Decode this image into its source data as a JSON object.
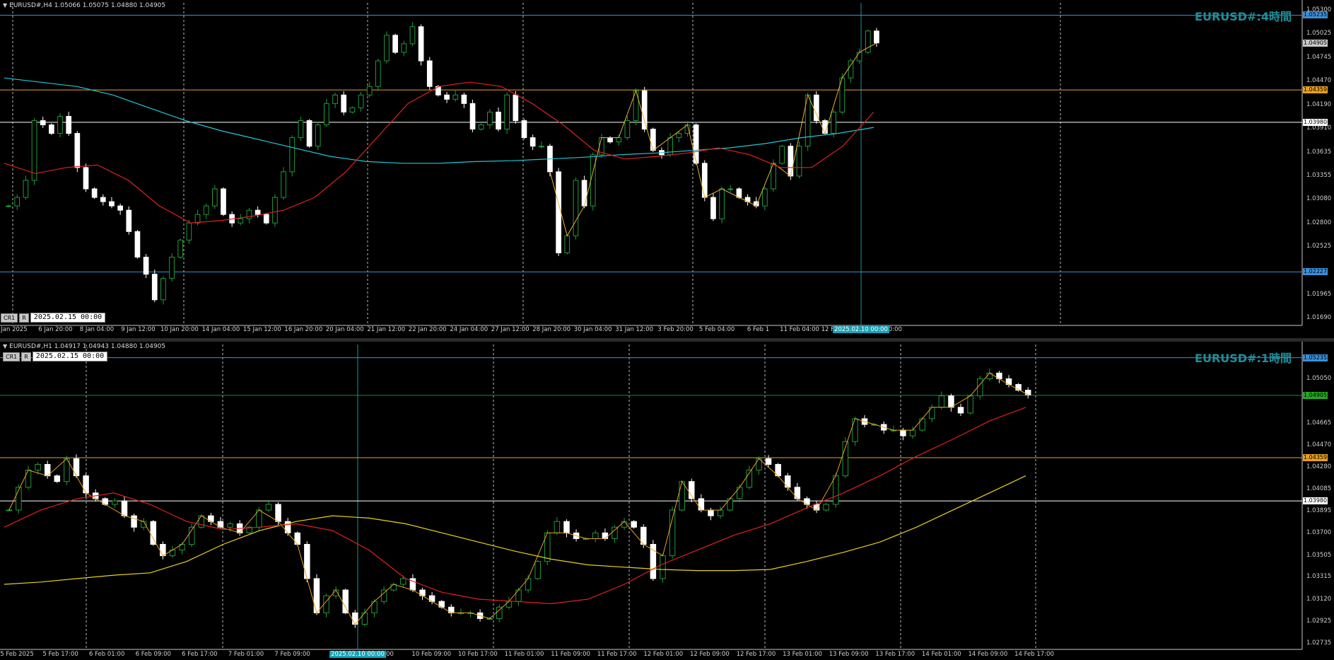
{
  "window": {
    "top_border_color": "#00c000"
  },
  "chart_data": [
    {
      "type": "candlestick",
      "symbol_label": "EURUSD#:4時間",
      "header": "EURUSD#,H4  1.05066 1.05075 1.04880 1.04905",
      "controls": {
        "btn1": "CR1",
        "btn2": "R",
        "date": "2025.02.15 00:00"
      },
      "y_ticks": [
        "1.05300",
        "1.05025",
        "1.04745",
        "1.04470",
        "1.04190",
        "1.03910",
        "1.03635",
        "1.03355",
        "1.03080",
        "1.02800",
        "1.02525",
        "1.01965",
        "1.01690"
      ],
      "price_tags": [
        {
          "value": "1.05235",
          "color": "#3a8fd9"
        },
        {
          "value": "1.04905",
          "color": "#c8c8c8"
        },
        {
          "value": "1.04359",
          "color": "#e8a020"
        },
        {
          "value": "1.03980",
          "color": "#ffffff"
        },
        {
          "value": "1.02227",
          "color": "#3a8fd9"
        }
      ],
      "x_ticks": [
        "Jan 2025",
        "6 Jan 20:00",
        "8 Jan 04:00",
        "9 Jan 12:00",
        "10 Jan 20:00",
        "14 Jan 04:00",
        "15 Jan 12:00",
        "16 Jan 20:00",
        "20 Jan 04:00",
        "21 Jan 12:00",
        "22 Jan 20:00",
        "24 Jan 04:00",
        "27 Jan 12:00",
        "28 Jan 20:00",
        "30 Jan 04:00",
        "31 Jan 12:00",
        "3 Feb 20:00",
        "5 Feb 04:00",
        "6 Feb 1",
        "11 Feb 04:00",
        "12 Feb 12:00",
        "13 Feb 20:00"
      ],
      "x_cursor": "2025.02.10 00:00",
      "ylim": [
        1.016,
        1.0538
      ],
      "hlines": [
        {
          "y": 1.05235,
          "color": "#3a8fd9"
        },
        {
          "y": 1.04359,
          "color": "#e8a020"
        },
        {
          "y": 1.0398,
          "color": "#ffffff"
        },
        {
          "y": 1.02227,
          "color": "#3a8fd9"
        }
      ],
      "close": [
        1.03,
        1.031,
        1.033,
        1.04,
        1.0395,
        1.0385,
        1.0405,
        1.0385,
        1.0345,
        1.032,
        1.031,
        1.0305,
        1.03,
        1.0295,
        1.027,
        1.024,
        1.022,
        1.019,
        1.0215,
        1.024,
        1.026,
        1.028,
        1.029,
        1.03,
        1.032,
        1.029,
        1.028,
        1.0285,
        1.0295,
        1.029,
        1.028,
        1.031,
        1.034,
        1.038,
        1.04,
        1.037,
        1.0395,
        1.042,
        1.043,
        1.041,
        1.0415,
        1.043,
        1.044,
        1.047,
        1.05,
        1.048,
        1.049,
        1.051,
        1.047,
        1.044,
        1.043,
        1.0425,
        1.043,
        1.042,
        1.039,
        1.0395,
        1.041,
        1.039,
        1.043,
        1.04,
        1.038,
        1.037,
        1.037,
        1.034,
        1.0245,
        1.0265,
        1.033,
        1.03,
        1.036,
        1.038,
        1.0375,
        1.038,
        1.04,
        1.0435,
        1.039,
        1.0365,
        1.036,
        1.038,
        1.0385,
        1.0395,
        1.035,
        1.031,
        1.0285,
        1.032,
        1.032,
        1.031,
        1.0305,
        1.03,
        1.032,
        1.035,
        1.037,
        1.0335,
        1.037,
        1.043,
        1.04,
        1.0385,
        1.041,
        1.045,
        1.047,
        1.048,
        1.0505,
        1.0491
      ],
      "ma_cyan": [
        1.045,
        1.0445,
        1.044,
        1.043,
        1.0415,
        1.04,
        1.0388,
        1.0378,
        1.0368,
        1.0358,
        1.0352,
        1.035,
        1.035,
        1.0352,
        1.0353,
        1.0355,
        1.0357,
        1.036,
        1.0362,
        1.0365,
        1.0368,
        1.0373,
        1.038,
        1.0385,
        1.0392
      ],
      "ma_red": [
        1.035,
        1.0338,
        1.0345,
        1.0348,
        1.033,
        1.03,
        1.028,
        1.0283,
        1.0288,
        1.0295,
        1.031,
        1.034,
        1.038,
        1.042,
        1.044,
        1.0445,
        1.044,
        1.042,
        1.0395,
        1.0365,
        1.0355,
        1.0358,
        1.0362,
        1.0368,
        1.036,
        1.0345,
        1.0345,
        1.037,
        1.041
      ]
    },
    {
      "type": "candlestick",
      "symbol_label": "EURUSD#:1時間",
      "header": "EURUSD#,H1  1.04917 1.04943 1.04880 1.04905",
      "controls": {
        "btn1": "CR1",
        "btn2": "R",
        "date": "2025.02.15 00:00"
      },
      "y_ticks": [
        "1.05050",
        "1.04665",
        "1.04470",
        "1.04280",
        "1.04085",
        "1.03895",
        "1.03700",
        "1.03505",
        "1.03315",
        "1.03120",
        "1.02925",
        "1.02735"
      ],
      "price_tags": [
        {
          "value": "1.05235",
          "color": "#3a8fd9"
        },
        {
          "value": "1.04905",
          "color": "#22aa22"
        },
        {
          "value": "1.04359",
          "color": "#e8a020"
        },
        {
          "value": "1.03980",
          "color": "#ffffff"
        }
      ],
      "x_ticks": [
        "5 Feb 2025",
        "5 Feb 17:00",
        "6 Feb 01:00",
        "6 Feb 09:00",
        "6 Feb 17:00",
        "7 Feb 01:00",
        "7 Feb 09:00",
        "7 F",
        "01:00",
        "10 Feb 09:00",
        "10 Feb 17:00",
        "11 Feb 01:00",
        "11 Feb 09:00",
        "11 Feb 17:00",
        "12 Feb 01:00",
        "12 Feb 09:00",
        "12 Feb 17:00",
        "13 Feb 01:00",
        "13 Feb 09:00",
        "13 Feb 17:00",
        "14 Feb 01:00",
        "14 Feb 09:00",
        "14 Feb 17:00"
      ],
      "x_cursor": "2025.02.10 00:00",
      "ylim": [
        1.0268,
        1.0535
      ],
      "hlines": [
        {
          "y": 1.05235,
          "color": "#3a8fd9"
        },
        {
          "y": 1.04905,
          "color": "#1f8a3a"
        },
        {
          "y": 1.04359,
          "color": "#e8a020"
        },
        {
          "y": 1.0398,
          "color": "#ffffff"
        }
      ],
      "close": [
        1.039,
        1.041,
        1.0425,
        1.043,
        1.042,
        1.0415,
        1.0435,
        1.042,
        1.0405,
        1.04,
        1.0395,
        1.0398,
        1.0385,
        1.0375,
        1.038,
        1.036,
        1.035,
        1.0355,
        1.036,
        1.0375,
        1.0385,
        1.038,
        1.0375,
        1.0378,
        1.037,
        1.0375,
        1.039,
        1.0395,
        1.038,
        1.037,
        1.036,
        1.033,
        1.03,
        1.0315,
        1.032,
        1.03,
        1.029,
        1.03,
        1.031,
        1.032,
        1.0325,
        1.033,
        1.032,
        1.0315,
        1.031,
        1.0305,
        1.03,
        1.03,
        1.03,
        1.0295,
        1.0295,
        1.0305,
        1.031,
        1.032,
        1.033,
        1.0345,
        1.037,
        1.038,
        1.037,
        1.0365,
        1.0365,
        1.037,
        1.0365,
        1.0375,
        1.038,
        1.0375,
        1.036,
        1.033,
        1.035,
        1.039,
        1.0415,
        1.04,
        1.039,
        1.0385,
        1.039,
        1.04,
        1.041,
        1.0425,
        1.0435,
        1.043,
        1.042,
        1.041,
        1.04,
        1.0395,
        1.039,
        1.0395,
        1.042,
        1.045,
        1.047,
        1.0465,
        1.0465,
        1.046,
        1.046,
        1.0455,
        1.046,
        1.047,
        1.048,
        1.049,
        1.048,
        1.0475,
        1.049,
        1.0505,
        1.051,
        1.0505,
        1.05,
        1.0495,
        1.0491
      ],
      "ma_yellow": [
        1.0325,
        1.0327,
        1.033,
        1.0333,
        1.0335,
        1.0345,
        1.036,
        1.0372,
        1.038,
        1.0385,
        1.0383,
        1.0378,
        1.037,
        1.0362,
        1.0354,
        1.0347,
        1.0342,
        1.034,
        1.0338,
        1.0337,
        1.0337,
        1.0338,
        1.0345,
        1.0353,
        1.0362,
        1.0375,
        1.039,
        1.0405,
        1.042
      ],
      "ma_red": [
        1.0375,
        1.039,
        1.04,
        1.0405,
        1.0395,
        1.038,
        1.0373,
        1.0375,
        1.0378,
        1.0372,
        1.0355,
        1.033,
        1.0318,
        1.0312,
        1.031,
        1.0308,
        1.0312,
        1.0325,
        1.0342,
        1.0355,
        1.0368,
        1.0378,
        1.0392,
        1.0405,
        1.042,
        1.0437,
        1.0452,
        1.0468,
        1.048
      ]
    }
  ]
}
